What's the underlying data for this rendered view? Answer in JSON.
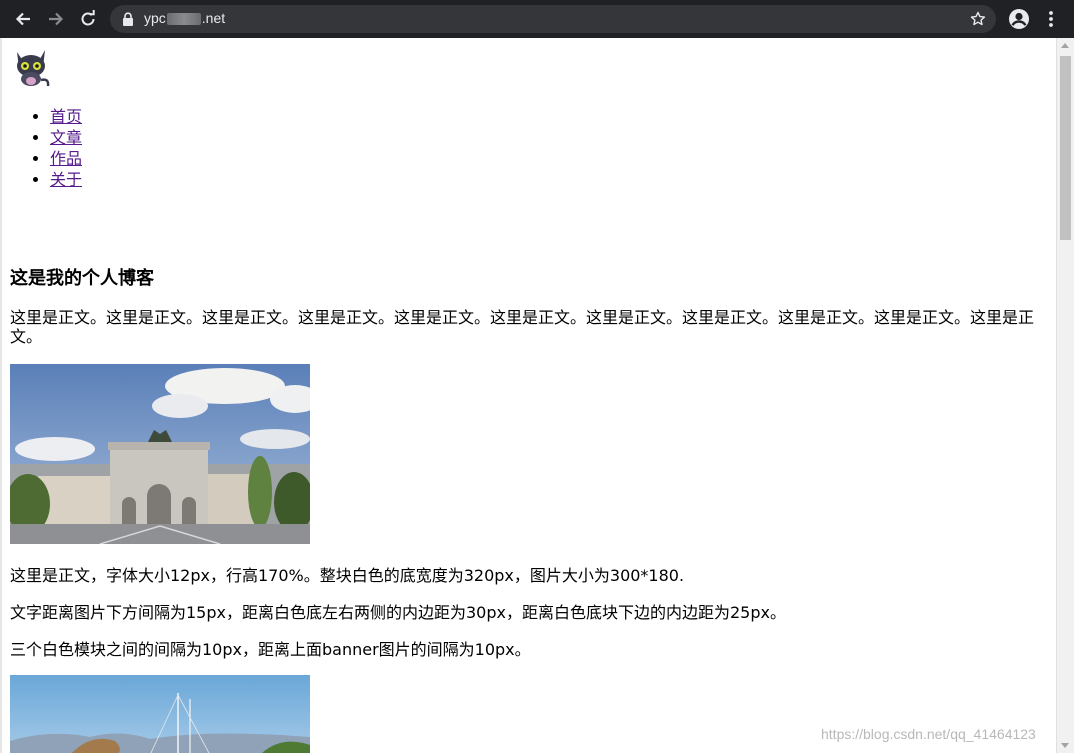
{
  "browser": {
    "url_prefix": "ypc",
    "url_suffix": ".net"
  },
  "nav": {
    "items": [
      {
        "label": "首页"
      },
      {
        "label": "文章"
      },
      {
        "label": "作品"
      },
      {
        "label": "关于"
      }
    ],
    "link_color": "#551a8b"
  },
  "article": {
    "title": "这是我的个人博客",
    "intro": "这里是正文。这里是正文。这里是正文。这里是正文。这里是正文。这里是正文。这里是正文。这里是正文。这里是正文。这里是正文。这里是正文。",
    "paragraphs": [
      "这里是正文，字体大小12px，行高170%。整块白色的底宽度为320px，图片大小为300*180.",
      "文字距离图片下方间隔为15px，距离白色底左右两侧的内边距为30px，距离白色底块下边的内边距为25px。",
      "三个白色模块之间的间隔为10px，距离上面banner图片的间隔为10px。"
    ]
  },
  "watermark": "https://blog.csdn.net/qq_41464123",
  "icons": {
    "back": "arrow-left-icon",
    "forward": "arrow-right-icon",
    "reload": "reload-icon",
    "lock": "lock-icon",
    "star": "star-icon",
    "account": "account-icon",
    "menu": "kebab-menu-icon",
    "logo": "cat-logo-icon"
  }
}
